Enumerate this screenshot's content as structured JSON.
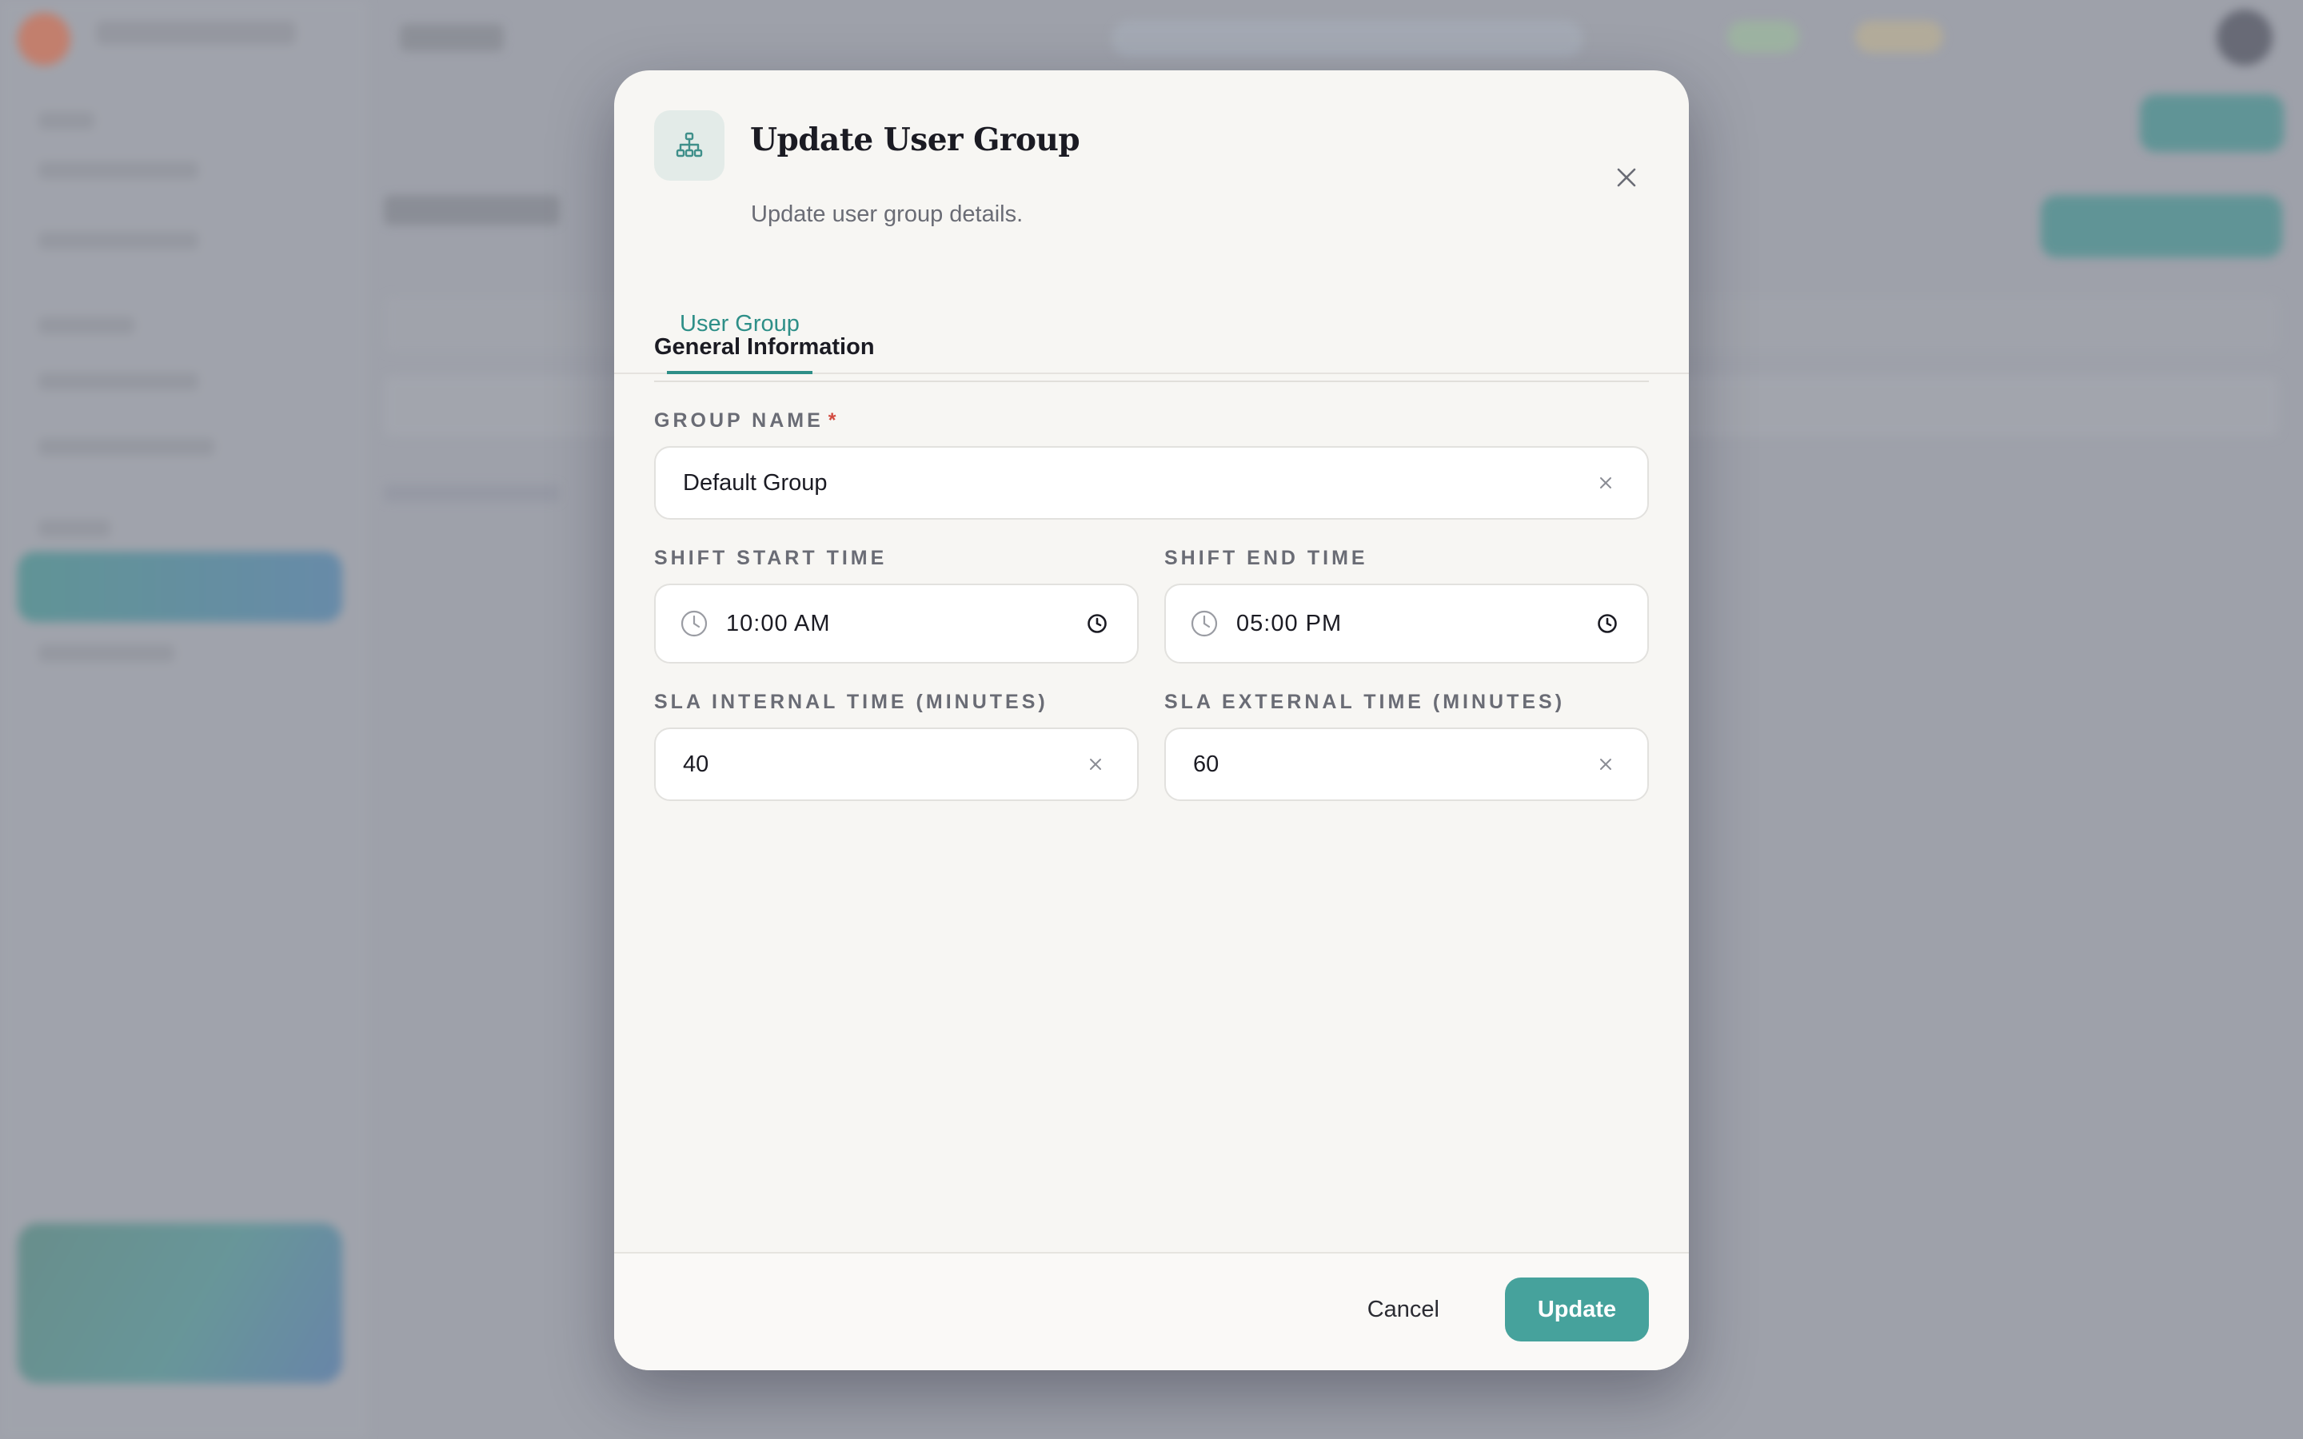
{
  "modal": {
    "title": "Update User Group",
    "subtitle": "Update user group details.",
    "icon": "org-chart-icon",
    "close_icon": "close-icon"
  },
  "tabs": [
    {
      "label": "User Group",
      "active": true
    }
  ],
  "section": {
    "title": "General Information"
  },
  "form": {
    "group_name": {
      "label": "GROUP NAME",
      "required_marker": "*",
      "value": "Default Group"
    },
    "shift_start": {
      "label": "SHIFT START TIME",
      "value": "10:00 AM"
    },
    "shift_end": {
      "label": "SHIFT END TIME",
      "value": "05:00 PM"
    },
    "sla_internal": {
      "label": "SLA INTERNAL TIME (MINUTES)",
      "value": "40"
    },
    "sla_external": {
      "label": "SLA EXTERNAL TIME (MINUTES)",
      "value": "60"
    }
  },
  "footer": {
    "cancel_label": "Cancel",
    "update_label": "Update"
  },
  "colors": {
    "accent": "#46a29c",
    "accent_text": "#2e8f88",
    "required": "#d24a3f",
    "overlay": "#9ea1aa"
  }
}
